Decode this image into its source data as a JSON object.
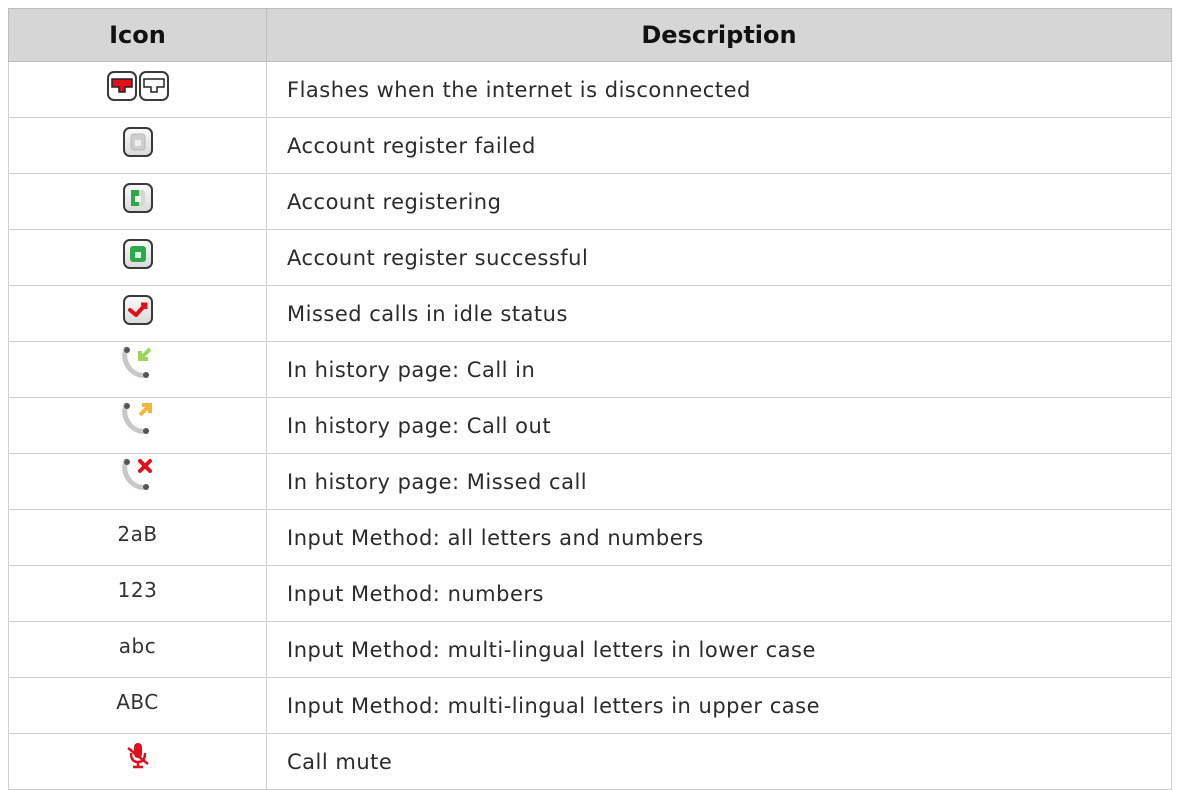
{
  "table": {
    "headers": {
      "icon": "Icon",
      "description": "Description"
    },
    "rows": [
      {
        "icon": "network-disconnected-icon",
        "description": "Flashes when the internet is disconnected"
      },
      {
        "icon": "account-register-failed-icon",
        "description": "Account register failed"
      },
      {
        "icon": "account-registering-icon",
        "description": "Account registering"
      },
      {
        "icon": "account-register-successful-icon",
        "description": "Account register successful"
      },
      {
        "icon": "missed-calls-idle-icon",
        "description": "Missed calls in idle status"
      },
      {
        "icon": "call-in-icon",
        "description": "In history page: Call in"
      },
      {
        "icon": "call-out-icon",
        "description": "In history page: Call out"
      },
      {
        "icon": "missed-call-icon",
        "description": "In history page: Missed call"
      },
      {
        "icon_text": "2aB",
        "description": "Input Method: all letters and numbers"
      },
      {
        "icon_text": "123",
        "description": "Input Method: numbers"
      },
      {
        "icon_text": "abc",
        "description": "Input Method: multi-lingual letters in lower case"
      },
      {
        "icon_text": "ABC",
        "description": "Input Method: multi-lingual letters in upper case"
      },
      {
        "icon": "call-mute-icon",
        "description": "Call mute"
      }
    ]
  },
  "colors": {
    "header_bg": "#d6d6d6",
    "red": "#e0101a",
    "green": "#2fa84a",
    "arrow_in": "#9cd65a",
    "arrow_out": "#f3b53a"
  }
}
